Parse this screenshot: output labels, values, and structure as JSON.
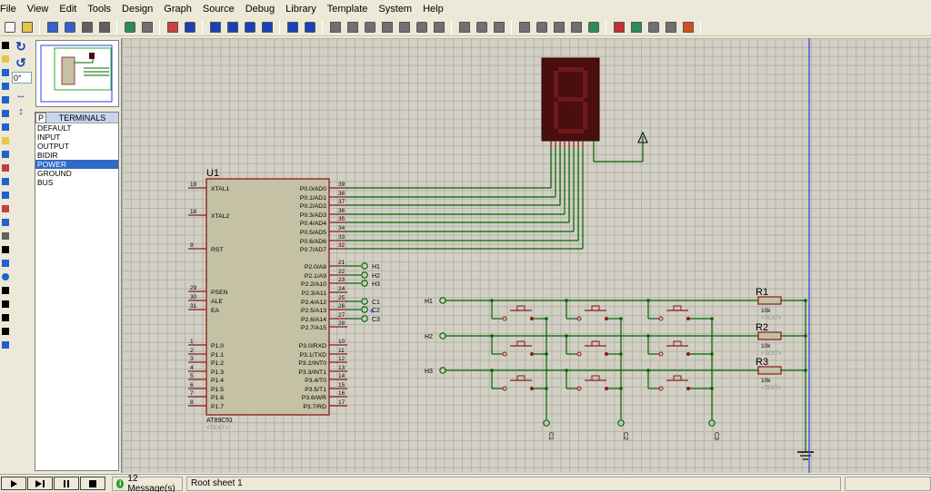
{
  "menu": [
    "File",
    "View",
    "Edit",
    "Tools",
    "Design",
    "Graph",
    "Source",
    "Debug",
    "Library",
    "Template",
    "System",
    "Help"
  ],
  "toolbar_icons": [
    "new-file-icon",
    "open-folder-icon",
    "save-icon",
    "save-all-icon",
    "print-icon",
    "print-setup-icon",
    "refresh-icon",
    "grid-icon",
    "origin-icon",
    "pan-icon",
    "zoom-in-icon",
    "zoom-out-icon",
    "zoom-all-icon",
    "zoom-area-icon",
    "undo-icon",
    "redo-icon",
    "cut-icon",
    "copy-icon",
    "paste-icon",
    "block-copy-icon",
    "block-move-icon",
    "block-rotate-icon",
    "block-delete-icon",
    "pick-device-icon",
    "make-device-icon",
    "package-icon",
    "decompose-icon",
    "wire-autorouter-icon",
    "search-tag-icon",
    "property-assign-icon",
    "new-sheet-icon",
    "remove-sheet-icon",
    "exit-parent-icon",
    "bill-of-materials-icon",
    "netlist-icon",
    "ares-icon"
  ],
  "left_tools": [
    "selection-mode-icon",
    "component-mode-icon",
    "junction-dot-icon",
    "wire-label-icon",
    "text-script-icon",
    "buses-icon",
    "subcircuit-icon",
    "terminals-mode-icon",
    "device-pins-icon",
    "graph-mode-icon",
    "tape-recorder-icon",
    "generator-icon",
    "voltage-probe-icon",
    "current-probe-icon",
    "virtual-instruments-icon",
    "line-icon",
    "box-icon",
    "circle-icon",
    "arc-icon",
    "path-icon",
    "text-icon",
    "symbol-icon",
    "marker-icon"
  ],
  "rotate": {
    "cw_icon": "↻",
    "ccw_icon": "↺",
    "angle": "0°"
  },
  "terminals": {
    "mode": "P",
    "title": "TERMINALS",
    "items": [
      "DEFAULT",
      "INPUT",
      "OUTPUT",
      "BIDIR",
      "POWER",
      "GROUND",
      "BUS"
    ],
    "selected": "POWER"
  },
  "schematic": {
    "mcu": {
      "ref": "U1",
      "part": "AT89C51",
      "text": "<TEXT>",
      "left_pins": [
        {
          "num": "19",
          "name": "XTAL1"
        },
        {
          "num": "18",
          "name": "XTAL2"
        },
        {
          "num": "9",
          "name": "RST"
        },
        {
          "num": "29",
          "name": "PSEN"
        },
        {
          "num": "30",
          "name": "ALE"
        },
        {
          "num": "31",
          "name": "EA"
        },
        {
          "num": "1",
          "name": "P1.0"
        },
        {
          "num": "2",
          "name": "P1.1"
        },
        {
          "num": "3",
          "name": "P1.2"
        },
        {
          "num": "4",
          "name": "P1.3"
        },
        {
          "num": "5",
          "name": "P1.4"
        },
        {
          "num": "6",
          "name": "P1.5"
        },
        {
          "num": "7",
          "name": "P1.6"
        },
        {
          "num": "8",
          "name": "P1.7"
        }
      ],
      "right_pins": [
        {
          "num": "39",
          "name": "P0.0/AD0"
        },
        {
          "num": "38",
          "name": "P0.1/AD1"
        },
        {
          "num": "37",
          "name": "P0.2/AD2"
        },
        {
          "num": "36",
          "name": "P0.3/AD3"
        },
        {
          "num": "35",
          "name": "P0.4/AD4"
        },
        {
          "num": "34",
          "name": "P0.5/AD5"
        },
        {
          "num": "33",
          "name": "P0.6/AD6"
        },
        {
          "num": "32",
          "name": "P0.7/AD7"
        },
        {
          "num": "21",
          "name": "P2.0/A8"
        },
        {
          "num": "22",
          "name": "P2.1/A9"
        },
        {
          "num": "23",
          "name": "P2.2/A10"
        },
        {
          "num": "24",
          "name": "P2.3/A11"
        },
        {
          "num": "25",
          "name": "P2.4/A12"
        },
        {
          "num": "26",
          "name": "P2.5/A13"
        },
        {
          "num": "27",
          "name": "P2.6/A14"
        },
        {
          "num": "28",
          "name": "P2.7/A15"
        },
        {
          "num": "10",
          "name": "P3.0/RXD"
        },
        {
          "num": "11",
          "name": "P3.1/TXD"
        },
        {
          "num": "12",
          "name": "P3.2/INT0"
        },
        {
          "num": "13",
          "name": "P3.3/INT1"
        },
        {
          "num": "14",
          "name": "P3.4/T0"
        },
        {
          "num": "15",
          "name": "P3.5/T1"
        },
        {
          "num": "16",
          "name": "P3.6/WR"
        },
        {
          "num": "17",
          "name": "P3.7/RD"
        }
      ],
      "port2_terminals": [
        "H1",
        "H2",
        "H3",
        "",
        "C1",
        "C2",
        "C3"
      ]
    },
    "row_terminals": [
      "H1",
      "H2",
      "H3"
    ],
    "col_terminals": [
      "C1",
      "C2",
      "C3"
    ],
    "resistors": [
      {
        "ref": "R1",
        "value": "10k",
        "text": "<TEXT>"
      },
      {
        "ref": "R2",
        "value": "10k",
        "text": "<TEXT>"
      },
      {
        "ref": "R3",
        "value": "10k",
        "text": "<TEXT>"
      }
    ],
    "display_digit": "8"
  },
  "status": {
    "sim_buttons": [
      "play-icon",
      "step-icon",
      "pause-icon",
      "stop-icon"
    ],
    "messages": "12 Message(s)",
    "sheet": "Root sheet 1"
  },
  "colors": {
    "wire": "#006400",
    "component": "#8b1a1a",
    "component_fill": "#c4c1a4",
    "grid": "#d2d0c4",
    "display_bg": "#4a0e0e",
    "display_seg": "#6e1a1a"
  }
}
